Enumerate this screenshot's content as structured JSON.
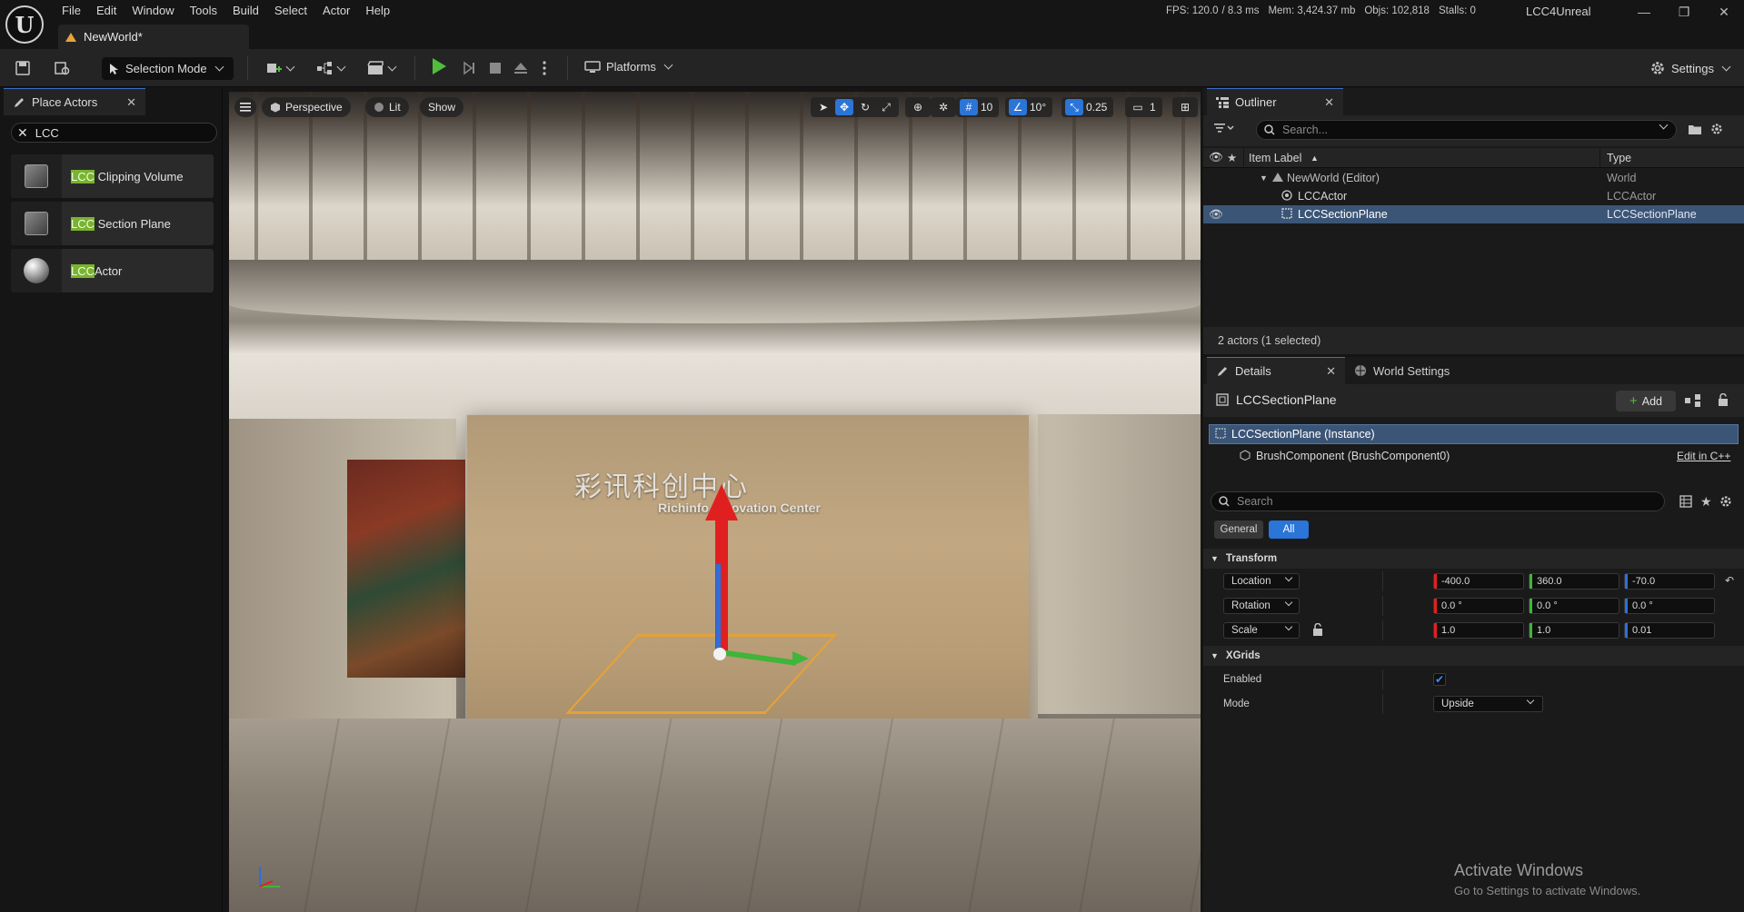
{
  "window": {
    "doc_tab": "NewWorld*",
    "app_name": "LCC4Unreal",
    "logo_letter": "U",
    "stats": {
      "fps": "FPS: 120.0",
      "ms": "/ 8.3 ms",
      "mem": "Mem: 3,424.37 mb",
      "objs": "Objs: 102,818",
      "stalls": "Stalls: 0"
    },
    "controls": {
      "minimize": "—",
      "restore": "❐",
      "close": "✕"
    }
  },
  "menu": [
    "File",
    "Edit",
    "Window",
    "Tools",
    "Build",
    "Select",
    "Actor",
    "Help"
  ],
  "toolbar": {
    "selection_mode": "Selection Mode",
    "platforms": "Platforms",
    "settings": "Settings"
  },
  "place_actors": {
    "tab_label": "Place Actors",
    "search_value": "LCC",
    "items": [
      {
        "highlight": "LCC",
        "rest": " Clipping Volume",
        "icon": "cube-icon"
      },
      {
        "highlight": "LCC",
        "rest": " Section Plane",
        "icon": "cube-icon"
      },
      {
        "highlight": "LCC",
        "rest": "Actor",
        "icon": "sphere-icon"
      }
    ]
  },
  "viewport": {
    "perspective": "Perspective",
    "lit": "Lit",
    "show": "Show",
    "grid_snap": "10",
    "rot_snap": "10°",
    "scale_snap": "0.25",
    "camera_speed": "1",
    "sign_cn": "彩讯科创中心",
    "sign_en": "Richinfo Innovation Center"
  },
  "outliner": {
    "tab_label": "Outliner",
    "search_placeholder": "Search...",
    "col_label": "Item Label",
    "col_type": "Type",
    "rows": [
      {
        "label": "NewWorld (Editor)",
        "type": "World"
      },
      {
        "label": "LCCActor",
        "type": "LCCActor"
      },
      {
        "label": "LCCSectionPlane",
        "type": "LCCSectionPlane"
      }
    ],
    "footer": "2 actors (1 selected)"
  },
  "details": {
    "tab_label": "Details",
    "world_settings_label": "World Settings",
    "title": "LCCSectionPlane",
    "add_label": "Add",
    "instance_label": "LCCSectionPlane (Instance)",
    "component_label": "BrushComponent (BrushComponent0)",
    "edit_cpp": "Edit in C++",
    "search_placeholder": "Search",
    "filter_general": "General",
    "filter_all": "All",
    "transform_section": "Transform",
    "location_label": "Location",
    "rotation_label": "Rotation",
    "scale_label": "Scale",
    "location": [
      "-400.0",
      "360.0",
      "-70.0"
    ],
    "rotation": [
      "0.0 °",
      "0.0 °",
      "0.0 °"
    ],
    "scale": [
      "1.0",
      "1.0",
      "0.01"
    ],
    "xgrids_section": "XGrids",
    "enabled_label": "Enabled",
    "enabled_value": true,
    "mode_label": "Mode",
    "mode_value": "Upside"
  },
  "watermark": {
    "line1": "Activate Windows",
    "line2": "Go to Settings to activate Windows."
  },
  "colors": {
    "accent": "#2b74d8",
    "play": "#4fbf3a",
    "gizmo_x": "#e02020",
    "gizmo_y": "#3fb53a",
    "gizmo_z": "#2a6fe0",
    "selection_outline": "#e3a23a",
    "search_highlight": "#7ab32e"
  }
}
